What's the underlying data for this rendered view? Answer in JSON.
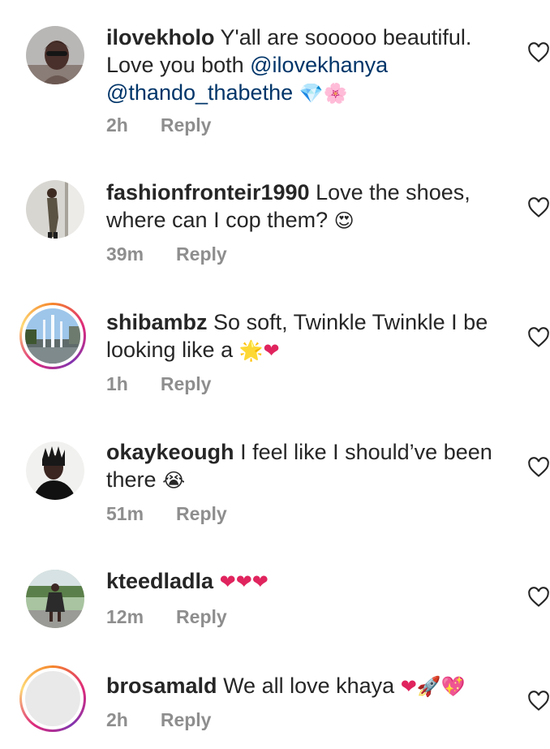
{
  "comments": [
    {
      "username": "ilovekholo",
      "text_1": "Y'all are sooooo beautiful.",
      "text_2": "Love you both ",
      "mention_1": "@ilovekhanya",
      "mention_2": "@thando_thabethe",
      "emoji": "💎🌸",
      "time": "2h",
      "reply_label": "Reply"
    },
    {
      "username": "fashionfronteir1990",
      "text_1": "Love the shoes,",
      "text_2": "where can I cop them?",
      "emoji": "😍",
      "time": "39m",
      "reply_label": "Reply"
    },
    {
      "username": "shibambz",
      "text_1": "So soft, Twinkle Twinkle I be",
      "text_2": "looking like a",
      "emoji": "🌟❤",
      "time": "1h",
      "reply_label": "Reply"
    },
    {
      "username": "okaykeough",
      "text_1": "I feel like I should’ve been",
      "text_2": "there",
      "emoji": "😭",
      "time": "51m",
      "reply_label": "Reply"
    },
    {
      "username": "kteedladla",
      "emoji": "❤❤❤",
      "time": "12m",
      "reply_label": "Reply"
    },
    {
      "username": "brosamald",
      "text_1": "We all love khaya",
      "emoji": "❤🚀💖",
      "time": "2h",
      "reply_label": "Reply"
    }
  ],
  "colors": {
    "text": "#262626",
    "meta": "#8e8e8e",
    "mention": "#003569",
    "heart_emoji": "#e0245e",
    "story_ring": [
      "#f58529",
      "#dd2a7b",
      "#8134af"
    ]
  },
  "icons": {
    "like": "heart-outline-icon"
  }
}
